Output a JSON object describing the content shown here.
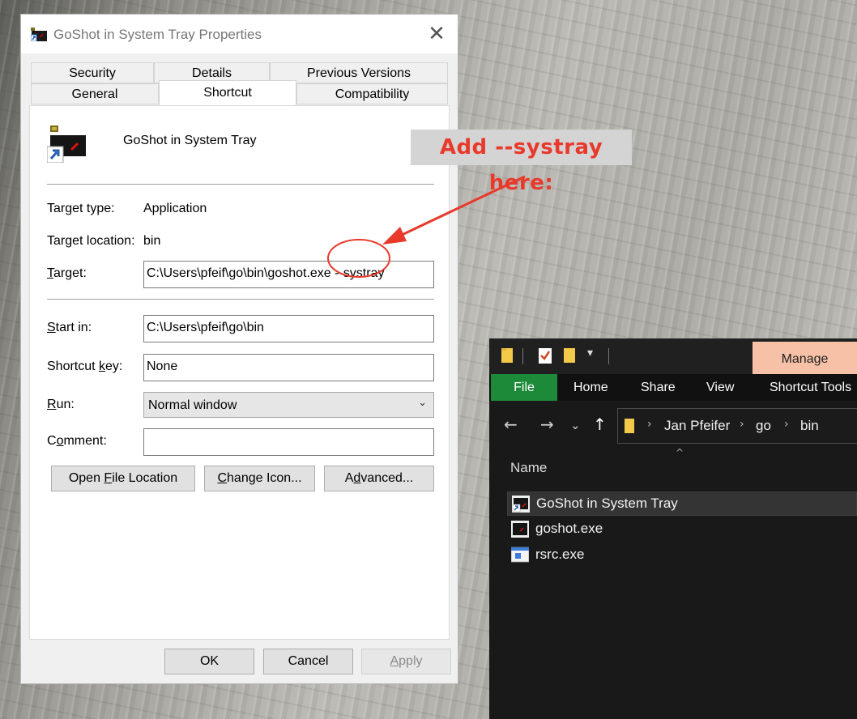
{
  "dialog": {
    "title": "GoShot in System Tray Properties",
    "tabs_row1": [
      "Security",
      "Details",
      "Previous Versions"
    ],
    "tabs_row2": [
      "General",
      "Shortcut",
      "Compatibility"
    ],
    "active_tab": "Shortcut",
    "shortcut_name": "GoShot in System Tray",
    "labels": {
      "target_type": "Target type:",
      "target_location": "Target location:",
      "target": "Target:",
      "start_in": "Start in:",
      "shortcut_key": "Shortcut key:",
      "run": "Run:",
      "comment": "Comment:"
    },
    "values": {
      "target_type": "Application",
      "target_location": "bin",
      "target": "C:\\Users\\pfeif\\go\\bin\\goshot.exe --systray",
      "start_in": "C:\\Users\\pfeif\\go\\bin",
      "shortcut_key": "None",
      "run": "Normal window",
      "comment": ""
    },
    "buttons": {
      "open_file_location": "Open File Location",
      "change_icon": "Change Icon...",
      "advanced": "Advanced...",
      "ok": "OK",
      "cancel": "Cancel",
      "apply": "Apply"
    }
  },
  "annotation": {
    "callout_text": "Add --systray here:",
    "color": "#e8392b"
  },
  "explorer": {
    "contextual_tab": "Manage",
    "ribbon_tabs": [
      "File",
      "Home",
      "Share",
      "View",
      "Shortcut Tools"
    ],
    "breadcrumb": [
      "Jan Pfeifer",
      "go",
      "bin"
    ],
    "column_header": "Name",
    "files": [
      {
        "name": "GoShot in System Tray",
        "icon": "shortcut-icon",
        "selected": true
      },
      {
        "name": "goshot.exe",
        "icon": "app-exe-icon",
        "selected": false
      },
      {
        "name": "rsrc.exe",
        "icon": "exe-icon",
        "selected": false
      }
    ],
    "accent_colors": {
      "file_tab": "#1d8a3a",
      "manage_tab": "#f6c1a7"
    }
  }
}
